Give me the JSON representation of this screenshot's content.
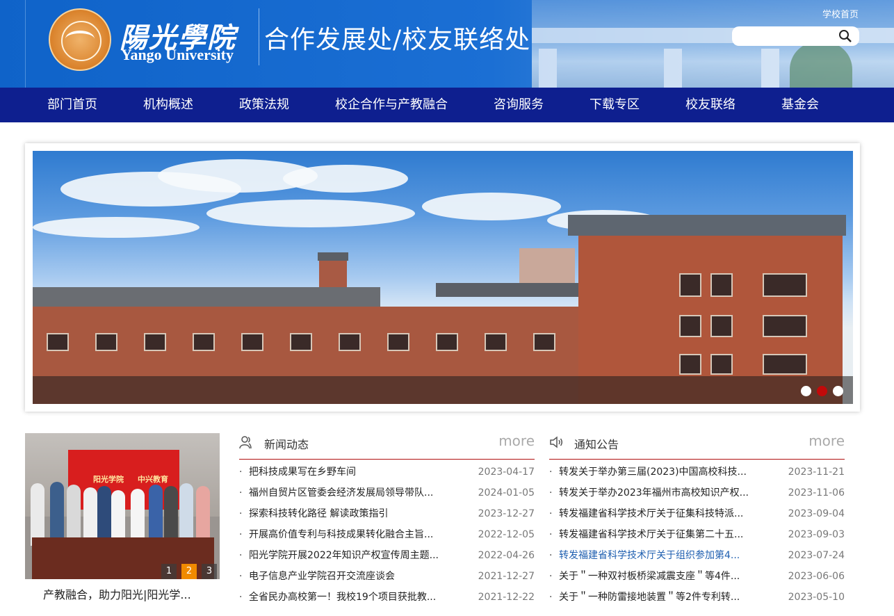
{
  "header": {
    "logo_cn": "陽光學院",
    "logo_en": "Yango University",
    "department": "合作发展处/校友联络处",
    "school_link": "学校首页",
    "search": {
      "value": "",
      "placeholder": ""
    },
    "colors": {
      "header_blue": "#0f63c9",
      "nav_bg": "#0e1f8f",
      "accent_red": "#b01010"
    }
  },
  "nav": [
    "部门首页",
    "机构概述",
    "政策法规",
    "校企合作与产教融合",
    "咨询服务",
    "下载专区",
    "校友联络",
    "基金会"
  ],
  "banner": {
    "active_dot": 2,
    "dot_count": 3
  },
  "photo": {
    "screen_left": "阳光学院",
    "screen_right": "中兴教育",
    "caption": "产教融合，助力阳光|阳光学...",
    "pages": [
      "1",
      "2",
      "3"
    ],
    "active_page": 2
  },
  "news": {
    "title": "新闻动态",
    "more": "more",
    "icon": "user-group-icon",
    "items": [
      {
        "title": "把科技成果写在乡野车间",
        "date": "2023-04-17"
      },
      {
        "title": "福州自贸片区管委会经济发展局领导带队...",
        "date": "2024-01-05"
      },
      {
        "title": "探索科技转化路径 解读政策指引",
        "date": "2023-12-27"
      },
      {
        "title": "开展高价值专利与科技成果转化融合主旨...",
        "date": "2022-12-05"
      },
      {
        "title": "阳光学院开展2022年知识产权宣传周主题...",
        "date": "2022-04-26"
      },
      {
        "title": "电子信息产业学院召开交流座谈会",
        "date": "2021-12-27"
      },
      {
        "title": "全省民办高校第一！我校19个项目获批教...",
        "date": "2021-12-22"
      }
    ]
  },
  "notices": {
    "title": "通知公告",
    "more": "more",
    "icon": "speaker-icon",
    "items": [
      {
        "title": "转发关于举办第三届(2023)中国高校科技...",
        "date": "2023-11-21"
      },
      {
        "title": "转发关于举办2023年福州市高校知识产权...",
        "date": "2023-11-06"
      },
      {
        "title": "转发福建省科学技术厅关于征集科技特派...",
        "date": "2023-09-04"
      },
      {
        "title": "转发福建省科学技术厅关于征集第二十五...",
        "date": "2023-09-03"
      },
      {
        "title": "转发福建省科学技术厅关于组织参加第4...",
        "date": "2023-07-24",
        "highlight": true
      },
      {
        "title": "关于＂一种双衬板桥梁减震支座＂等4件...",
        "date": "2023-06-06"
      },
      {
        "title": "关于＂一种防雷接地装置＂等2件专利转...",
        "date": "2023-05-10"
      }
    ]
  },
  "bullet": "·"
}
